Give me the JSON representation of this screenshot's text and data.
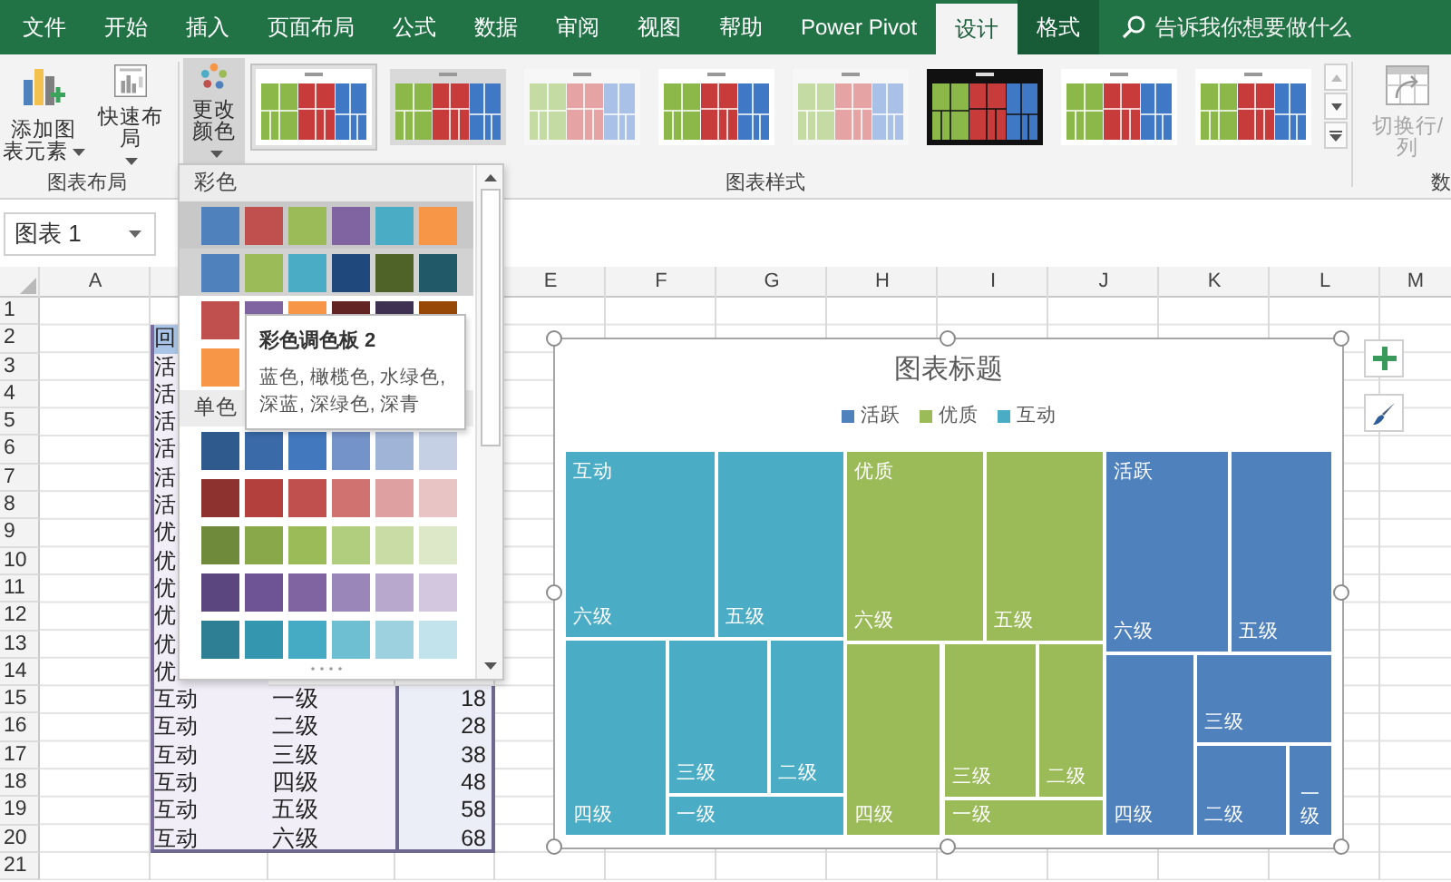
{
  "tabs": [
    {
      "label": "文件",
      "selected": false,
      "contextual": false
    },
    {
      "label": "开始",
      "selected": false,
      "contextual": false
    },
    {
      "label": "插入",
      "selected": false,
      "contextual": false
    },
    {
      "label": "页面布局",
      "selected": false,
      "contextual": false
    },
    {
      "label": "公式",
      "selected": false,
      "contextual": false
    },
    {
      "label": "数据",
      "selected": false,
      "contextual": false
    },
    {
      "label": "审阅",
      "selected": false,
      "contextual": false
    },
    {
      "label": "视图",
      "selected": false,
      "contextual": false
    },
    {
      "label": "帮助",
      "selected": false,
      "contextual": false
    },
    {
      "label": "Power Pivot",
      "selected": false,
      "contextual": false
    },
    {
      "label": "设计",
      "selected": true,
      "contextual": true
    },
    {
      "label": "格式",
      "selected": false,
      "contextual": true
    }
  ],
  "search": {
    "placeholder": "告诉我你想要做什么"
  },
  "ribbon": {
    "add_element": {
      "label": "添加图表元素"
    },
    "quick_layout": {
      "label": "快速布局"
    },
    "layout_group": "图表布局",
    "change_colors": {
      "label": "更改颜色",
      "pressed": true
    },
    "styles": [
      {
        "kind": "white",
        "selected": true
      },
      {
        "kind": "gray",
        "selected": false
      },
      {
        "kind": "pale",
        "selected": false
      },
      {
        "kind": "white",
        "selected": false
      },
      {
        "kind": "pale",
        "selected": false
      },
      {
        "kind": "dark",
        "selected": false
      },
      {
        "kind": "white",
        "selected": false
      },
      {
        "kind": "white",
        "selected": false
      }
    ],
    "styles_group": "图表样式",
    "switch_row_col": {
      "label": "切换行/列",
      "disabled": true
    },
    "data_group": "数"
  },
  "name_box": {
    "value": "图表 1"
  },
  "sheet": {
    "columns": [
      "A",
      "E",
      "F",
      "G",
      "H",
      "I",
      "J",
      "K",
      "L",
      "M"
    ],
    "rows": [
      {
        "number": "1"
      },
      {
        "number": "2",
        "cells": [
          {
            "text": "回",
            "kind": "header"
          }
        ]
      },
      {
        "number": "3",
        "cells": [
          {
            "text": "活",
            "kind": "data"
          }
        ]
      },
      {
        "number": "4",
        "cells": [
          {
            "text": "活",
            "kind": "data"
          }
        ]
      },
      {
        "number": "5",
        "cells": [
          {
            "text": "活",
            "kind": "data"
          }
        ]
      },
      {
        "number": "6",
        "cells": [
          {
            "text": "活",
            "kind": "data"
          }
        ]
      },
      {
        "number": "7",
        "cells": [
          {
            "text": "活",
            "kind": "data"
          }
        ]
      },
      {
        "number": "8",
        "cells": [
          {
            "text": "活",
            "kind": "data"
          }
        ]
      },
      {
        "number": "9",
        "cells": [
          {
            "text": "优",
            "kind": "data"
          }
        ]
      },
      {
        "number": "10",
        "cells": [
          {
            "text": "优",
            "kind": "data"
          }
        ]
      },
      {
        "number": "11",
        "cells": [
          {
            "text": "优",
            "kind": "data"
          }
        ]
      },
      {
        "number": "12",
        "cells": [
          {
            "text": "优",
            "kind": "data"
          }
        ]
      },
      {
        "number": "13",
        "cells": [
          {
            "text": "优",
            "kind": "data"
          }
        ]
      },
      {
        "number": "14",
        "cells": [
          {
            "text": "优",
            "kind": "data"
          }
        ]
      },
      {
        "number": "15",
        "cells": [
          {
            "text": "互动",
            "kind": "data"
          },
          {
            "text": "一级",
            "kind": "data"
          },
          {
            "text": "18",
            "kind": "data"
          }
        ]
      },
      {
        "number": "16",
        "cells": [
          {
            "text": "互动",
            "kind": "data"
          },
          {
            "text": "二级",
            "kind": "data"
          },
          {
            "text": "28",
            "kind": "data"
          }
        ]
      },
      {
        "number": "17",
        "cells": [
          {
            "text": "互动",
            "kind": "data"
          },
          {
            "text": "三级",
            "kind": "data"
          },
          {
            "text": "38",
            "kind": "data"
          }
        ]
      },
      {
        "number": "18",
        "cells": [
          {
            "text": "互动",
            "kind": "data"
          },
          {
            "text": "四级",
            "kind": "data"
          },
          {
            "text": "48",
            "kind": "data"
          }
        ]
      },
      {
        "number": "19",
        "cells": [
          {
            "text": "互动",
            "kind": "data"
          },
          {
            "text": "五级",
            "kind": "data"
          },
          {
            "text": "58",
            "kind": "data"
          }
        ]
      },
      {
        "number": "20",
        "cells": [
          {
            "text": "互动",
            "kind": "data"
          },
          {
            "text": "六级",
            "kind": "data"
          },
          {
            "text": "68",
            "kind": "data"
          }
        ]
      },
      {
        "number": "21"
      }
    ]
  },
  "color_menu": {
    "sections": [
      {
        "title": "彩色",
        "palettes": [
          {
            "selected": true,
            "hovered": false,
            "swatches": [
              {
                "color": "#4f81bd"
              },
              {
                "color": "#c0504d"
              },
              {
                "color": "#9bbb59"
              },
              {
                "color": "#8064a2"
              },
              {
                "color": "#4bacc6"
              },
              {
                "color": "#f79646"
              }
            ]
          },
          {
            "selected": false,
            "hovered": true,
            "swatches": [
              {
                "color": "#4f81bd"
              },
              {
                "color": "#9bbb59"
              },
              {
                "color": "#4bacc6"
              },
              {
                "color": "#1f497d"
              },
              {
                "color": "#4f6228"
              },
              {
                "color": "#215968"
              }
            ]
          },
          {
            "selected": false,
            "hovered": false,
            "swatches": [
              {
                "color": "#c0504d"
              },
              {
                "color": "#8064a2"
              },
              {
                "color": "#f79646"
              },
              {
                "color": "#632523"
              },
              {
                "color": "#3f3151"
              },
              {
                "color": "#974806"
              }
            ]
          },
          {
            "selected": false,
            "hovered": false,
            "swatches": [
              {
                "color": "#f79646"
              }
            ]
          }
        ]
      },
      {
        "title": "单色",
        "palettes": [
          {
            "selected": false,
            "hovered": false,
            "swatches": [
              {
                "color": "#2e5a8e"
              },
              {
                "color": "#3a6aa8"
              },
              {
                "color": "#4278be"
              },
              {
                "color": "#7493c8"
              },
              {
                "color": "#a0b4d8"
              },
              {
                "color": "#c5d0e5"
              }
            ]
          },
          {
            "selected": false,
            "hovered": false,
            "swatches": [
              {
                "color": "#8e3230"
              },
              {
                "color": "#b3403d"
              },
              {
                "color": "#c0504d"
              },
              {
                "color": "#d07270"
              },
              {
                "color": "#dea0a0"
              },
              {
                "color": "#e8c4c4"
              }
            ]
          },
          {
            "selected": false,
            "hovered": false,
            "swatches": [
              {
                "color": "#6f8a3a"
              },
              {
                "color": "#88a84a"
              },
              {
                "color": "#9bbb59"
              },
              {
                "color": "#b1cd7e"
              },
              {
                "color": "#c9dca5"
              },
              {
                "color": "#dde8c9"
              }
            ]
          },
          {
            "selected": false,
            "hovered": false,
            "swatches": [
              {
                "color": "#5b4680"
              },
              {
                "color": "#6e5495"
              },
              {
                "color": "#8064a2"
              },
              {
                "color": "#9a86b8"
              },
              {
                "color": "#b8a8cd"
              },
              {
                "color": "#d2c7de"
              }
            ]
          },
          {
            "selected": false,
            "hovered": false,
            "swatches": [
              {
                "color": "#2f7f94"
              },
              {
                "color": "#3596b0"
              },
              {
                "color": "#45aac4"
              },
              {
                "color": "#6fbfd3"
              },
              {
                "color": "#9dd1e0"
              },
              {
                "color": "#c2e2ec"
              }
            ]
          }
        ]
      }
    ]
  },
  "tooltip": {
    "title": "彩色调色板 2",
    "text": "蓝色, 橄榄色, 水绿色, 深蓝, 深绿色, 深青"
  },
  "chart": {
    "title": "图表标题",
    "legend": [
      {
        "label": "活跃",
        "color": "#4f81bd"
      },
      {
        "label": "优质",
        "color": "#9bbb59"
      },
      {
        "label": "互动",
        "color": "#4bacc6"
      }
    ],
    "groups": [
      {
        "name": "互动",
        "color": "#4bacc6",
        "tiles": [
          {
            "label": "六级"
          },
          {
            "label": "五级"
          },
          {
            "label": "四级"
          },
          {
            "label": "三级"
          },
          {
            "label": "二级"
          },
          {
            "label": "一级"
          }
        ]
      },
      {
        "name": "优质",
        "color": "#9bbb59",
        "tiles": [
          {
            "label": "六级"
          },
          {
            "label": "五级"
          },
          {
            "label": "四级"
          },
          {
            "label": "三级"
          },
          {
            "label": "二级"
          },
          {
            "label": "一级"
          }
        ]
      },
      {
        "name": "活跃",
        "color": "#4f81bd",
        "tiles": [
          {
            "label": "六级"
          },
          {
            "label": "五级"
          },
          {
            "label": "四级"
          },
          {
            "label": "三级"
          },
          {
            "label": "二级"
          },
          {
            "label": "一级"
          }
        ]
      }
    ]
  }
}
